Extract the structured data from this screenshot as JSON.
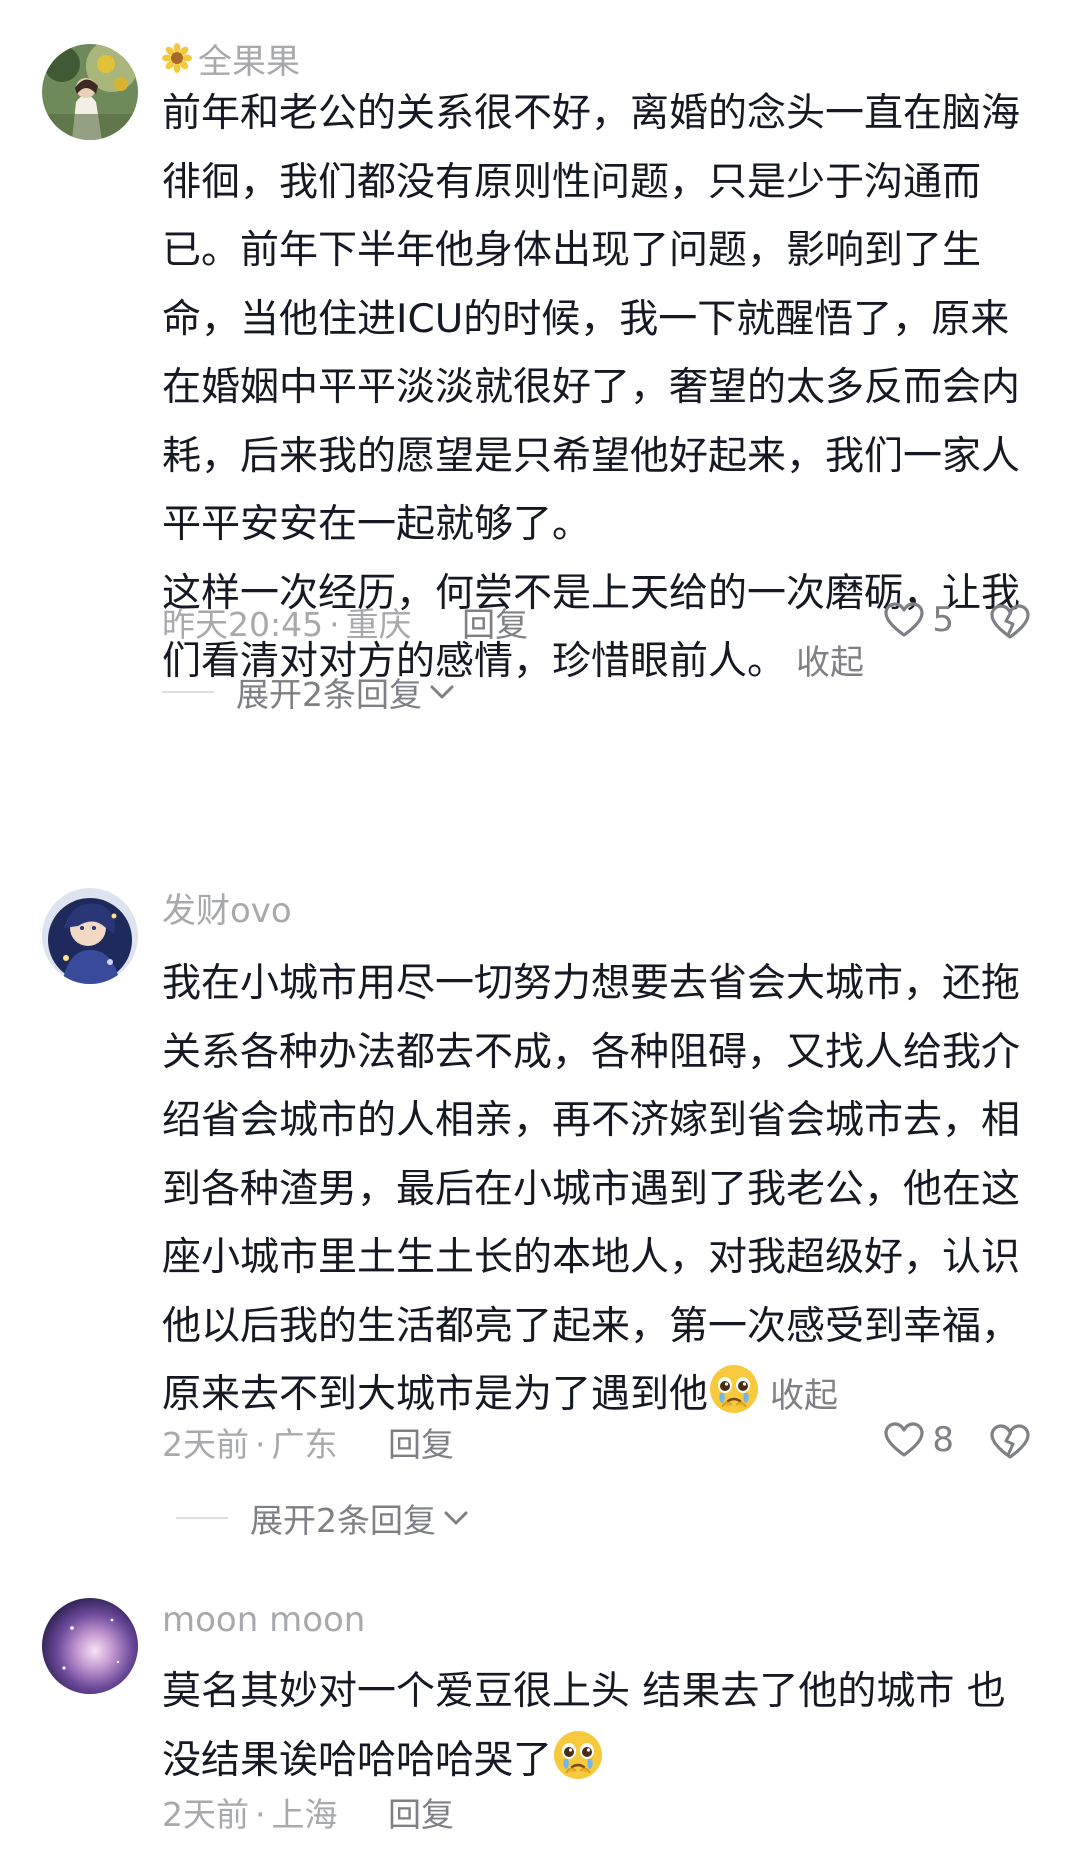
{
  "comments": [
    {
      "username": "全果果",
      "lines": [
        "前年和老公的关系很不好，离婚的念头一直在脑海徘徊，我们都没有原则性问题，只是少于沟通而已。前年下半年他身体出现了问题，影响到了生命，当他住进ICU的时候，我一下就醒悟了，原来在婚姻中平平淡淡就很好了，奢望的太多反而会内耗，后来我的愿望是只希望他好起来，我们一家人平平安安在一起就够了。",
        "这样一次经历，何尝不是上天给的一次磨砺，让我们看清对对方的感情，珍惜眼前人。"
      ],
      "collapse_label": "收起",
      "time": "昨天20:45",
      "separator": "·",
      "location": "重庆",
      "reply_label": "回复",
      "likes": "5",
      "expand_label": "展开2条回复",
      "avatar_icon": "avatar-photo-sunflower"
    },
    {
      "username": "发财ovo",
      "text": "我在小城市用尽一切努力想要去省会大城市，还拖关系各种办法都去不成，各种阻碍，又找人给我介绍省会城市的人相亲，再不济嫁到省会城市去，相到各种渣男，最后在小城市遇到了我老公，他在这座小城市里土生土长的本地人，对我超级好，认识他以后我的生活都亮了起来，第一次感受到幸福，原来去不到大城市是为了遇到他",
      "emoji": "pleading-face-emoji",
      "collapse_label": "收起",
      "time": "2天前",
      "separator": "·",
      "location": "广东",
      "reply_label": "回复",
      "likes": "8",
      "expand_label": "展开2条回复",
      "avatar_icon": "avatar-anime-night"
    },
    {
      "username": "moon moon",
      "text": "莫名其妙对一个爱豆很上头 结果去了他的城市 也没结果诶哈哈哈哈哭了",
      "emoji": "pleading-face-emoji",
      "time": "2天前",
      "separator": "·",
      "location": "上海",
      "reply_label": "回复",
      "avatar_icon": "avatar-purple-galaxy"
    }
  ],
  "colors": {
    "text": "#161823",
    "secondary": "#a8a9ad",
    "action": "#7f8085"
  }
}
